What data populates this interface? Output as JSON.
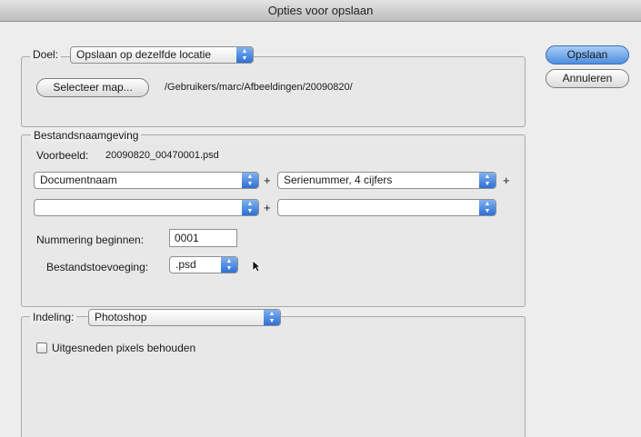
{
  "window": {
    "title": "Opties voor opslaan"
  },
  "buttons": {
    "save": "Opslaan",
    "cancel": "Annuleren"
  },
  "destination": {
    "label": "Doel:",
    "selected": "Opslaan op dezelfde locatie",
    "select_folder_button": "Selecteer map...",
    "path": "/Gebruikers/marc/Afbeeldingen/20090820/"
  },
  "naming": {
    "title": "Bestandsnaamgeving",
    "example_label": "Voorbeeld:",
    "example_value": "20090820_00470001.psd",
    "field1": "Documentnaam",
    "field2": "Serienummer, 4 cijfers",
    "field3": "",
    "field4": "",
    "plus": "+",
    "start_label": "Nummering beginnen:",
    "start_value": "0001",
    "extension_label": "Bestandstoevoeging:",
    "extension_value": ".psd"
  },
  "format": {
    "label": "Indeling:",
    "selected": "Photoshop",
    "keep_pixels_label": "Uitgesneden pixels behouden",
    "keep_pixels_checked": false
  },
  "icons": {
    "popup_arrows": "updown-arrows-icon",
    "cursor": "mouse-pointer-icon"
  }
}
